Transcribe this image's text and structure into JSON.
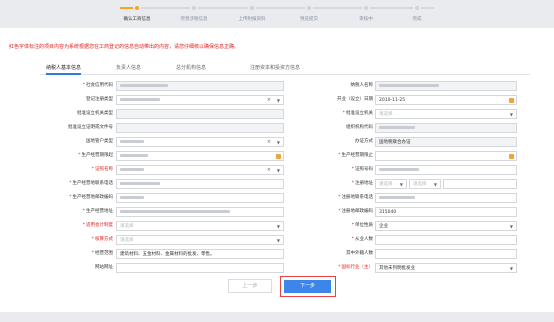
{
  "steps": [
    {
      "label": "确认工商信息",
      "active": true
    },
    {
      "label": "完善涉税信息",
      "active": false
    },
    {
      "label": "上传附报资料",
      "active": false
    },
    {
      "label": "预览提交",
      "active": false
    },
    {
      "label": "审核中",
      "active": false
    },
    {
      "label": "完成",
      "active": false
    }
  ],
  "notice": "红色字体标注的项目内容为系统根据您在工商登记的信息自动带出的内容，请您仔细核以确保信息正确。",
  "tabs": [
    "纳税人基本信息",
    "负责人信息",
    "总分机构信息",
    "注册资本和投资方信息"
  ],
  "form": {
    "left": [
      {
        "label": "社会信用代码",
        "required": true
      },
      {
        "label": "登记注册类型",
        "required": false
      },
      {
        "label": "批准设立机关类型",
        "required": false
      },
      {
        "label": "批准设立证明或文件号",
        "required": false
      },
      {
        "label": "国地管户类型",
        "required": false
      },
      {
        "label": "生产经营期限起",
        "required": true
      },
      {
        "label": "证照名称",
        "required": true,
        "red": true
      },
      {
        "label": "生产经营地联系电话",
        "required": true
      },
      {
        "label": "生产经营地邮政编码",
        "required": true
      },
      {
        "label": "生产经营地址",
        "required": true
      },
      {
        "label": "适用会计制度",
        "required": true,
        "red": true,
        "placeholder": "请选择"
      },
      {
        "label": "核算方式",
        "required": true,
        "red": true,
        "placeholder": "请选择"
      },
      {
        "label": "经营范围",
        "required": true,
        "value": "建筑材料、五金材料、金属材料的批发、零售。"
      },
      {
        "label": "网站网址",
        "required": false
      }
    ],
    "right": [
      {
        "label": "纳税人名称",
        "required": false
      },
      {
        "label": "开业（设立）日期",
        "required": false,
        "value": "2010-11-25"
      },
      {
        "label": "批准设立机关",
        "required": true
      },
      {
        "label": "组织机构代码",
        "required": false
      },
      {
        "label": "办证方式",
        "required": false,
        "value": "国地税联合办证"
      },
      {
        "label": "生产经营期限止",
        "required": true
      },
      {
        "label": "证照号码",
        "required": true
      },
      {
        "label": "注册地址",
        "required": true,
        "placeholder": "请选择"
      },
      {
        "label": "注册地联系电话",
        "required": true
      },
      {
        "label": "注册地邮政编码",
        "required": true,
        "value": "315040"
      },
      {
        "label": "单位性质",
        "required": true,
        "value": "企业"
      },
      {
        "label": "从业人数",
        "required": true
      },
      {
        "label": "其中外籍人数",
        "required": false
      },
      {
        "label": "国标行业（主）",
        "required": true,
        "red": true,
        "value": "其他未列明批发业"
      }
    ]
  },
  "buttons": {
    "prev": "上一步",
    "next": "下一步"
  }
}
